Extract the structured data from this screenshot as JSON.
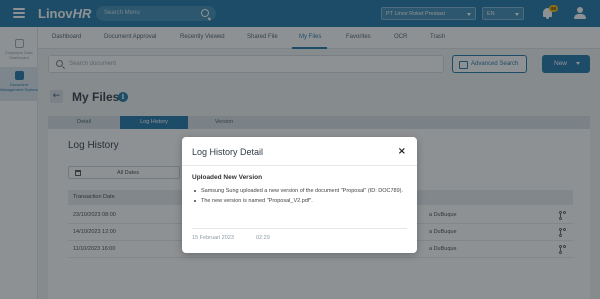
{
  "app": {
    "logo_main": "Linov",
    "logo_hr": "HR"
  },
  "topbar": {
    "search_placeholder": "Search Menu",
    "company": "PT Linov Roket Prestasi",
    "language": "EN",
    "notification_count": "99"
  },
  "sidebar": {
    "items": [
      {
        "label": "Employee Data Dashboard"
      },
      {
        "label": "Document Management System"
      }
    ]
  },
  "tabs": [
    {
      "label": "Dashboard"
    },
    {
      "label": "Document Approval"
    },
    {
      "label": "Recently Viewed"
    },
    {
      "label": "Shared File"
    },
    {
      "label": "My Files"
    },
    {
      "label": "Favorites"
    },
    {
      "label": "OCR"
    },
    {
      "label": "Trash"
    }
  ],
  "active_tab": "My Files",
  "search": {
    "placeholder": "Search document"
  },
  "buttons": {
    "advanced_search": "Advanced Search",
    "new": "New"
  },
  "page": {
    "title": "My Files"
  },
  "subtabs": [
    {
      "label": "Detail"
    },
    {
      "label": "Log History"
    },
    {
      "label": "Version"
    }
  ],
  "panel": {
    "title": "Log History",
    "date_filter": "All Dates",
    "column_date": "Transaction Date",
    "rows": [
      {
        "date": "23/10/2023 08:00",
        "user": "a DuBuque"
      },
      {
        "date": "14/10/2023 12:00",
        "user": "a DuBuque"
      },
      {
        "date": "11/10/2023 16:00",
        "user": "a DuBuque"
      }
    ]
  },
  "modal": {
    "title": "Log History Detail",
    "close": "×",
    "subtitle": "Uploaded New Version",
    "items": [
      "Samsung Sung uploaded a new version of the document \"Proposal\" (ID: DOC789).",
      "The new version is named \"Proposal_V2.pdf\"."
    ],
    "date": "15 Februari 2023",
    "time": "02:29"
  },
  "colors": {
    "primary": "#1b75a6",
    "badge": "#f5b800"
  }
}
